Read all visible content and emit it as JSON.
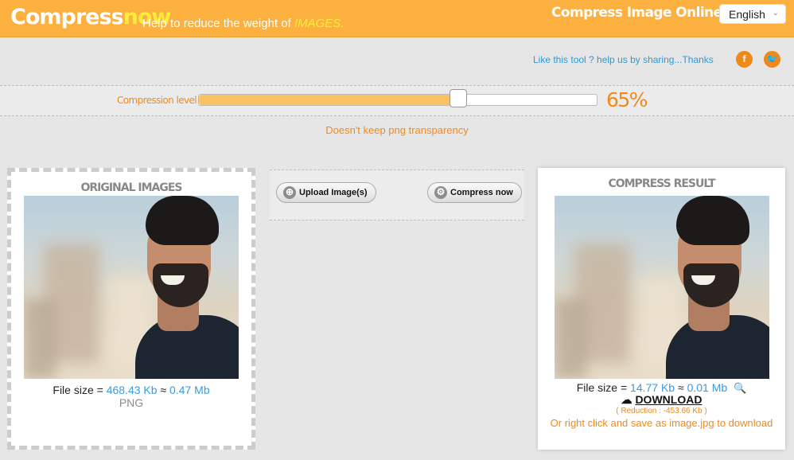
{
  "header": {
    "logo_main": "Compress",
    "logo_accent": "now",
    "tagline": "Help to reduce the weight of",
    "tagline_accent": "IMAGES.",
    "page_title": "Compress Image Online",
    "language": "English"
  },
  "share": {
    "text": "Like this tool ? help us by sharing...Thanks",
    "facebook_icon": "facebook-icon",
    "twitter_icon": "twitter-icon"
  },
  "compression": {
    "label": "Compression level",
    "value_text": "65%",
    "value": 65
  },
  "note": "Doesn't keep png transparency",
  "buttons": {
    "upload": "Upload Image(s)",
    "compress": "Compress now"
  },
  "original": {
    "title": "ORIGINAL IMAGES",
    "size_prefix": "File size =",
    "size_kb": "468.43 Kb",
    "approx": "≈",
    "size_mb": "0.47 Mb",
    "format": "PNG"
  },
  "result": {
    "title": "COMPRESS RESULT",
    "size_prefix": "File size =",
    "size_kb": "14.77 Kb",
    "approx": "≈",
    "size_mb": "0.01 Mb",
    "download": "DOWNLOAD",
    "reduction": "( Reduction : -453.66 Kb )",
    "hint": "Or right click and save as image.jpg to download"
  },
  "colors": {
    "header": "#fbb040",
    "accent_orange": "#ee8a1b",
    "link_blue": "#2a9ad6",
    "size_blue": "#3b9ae1"
  }
}
